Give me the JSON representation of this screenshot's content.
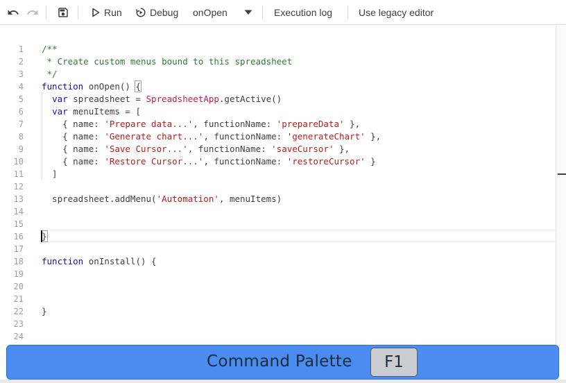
{
  "toolbar": {
    "undo_icon": "undo-icon",
    "redo_icon": "redo-icon",
    "save_icon": "save-icon",
    "run_label": "Run",
    "debug_label": "Debug",
    "function_select": "onOpen",
    "execution_log_label": "Execution log",
    "legacy_editor_label": "Use legacy editor"
  },
  "editor": {
    "line_numbers": [
      "1",
      "2",
      "3",
      "4",
      "5",
      "6",
      "7",
      "8",
      "9",
      "10",
      "11",
      "12",
      "13",
      "14",
      "15",
      "16",
      "17",
      "18",
      "19",
      "20",
      "21",
      "22",
      "23",
      "24"
    ],
    "cursor_line": "14",
    "code": [
      [
        {
          "t": "c",
          "s": "/**"
        }
      ],
      [
        {
          "t": "c",
          "s": " * Create custom menus bound to this spreadsheet"
        }
      ],
      [
        {
          "t": "c",
          "s": " */"
        }
      ],
      [
        {
          "t": "k",
          "s": "function"
        },
        {
          "t": "p",
          "s": " onOpen() "
        },
        {
          "t": "b",
          "s": "{"
        }
      ],
      [
        {
          "t": "p",
          "s": "  "
        },
        {
          "t": "k",
          "s": "var"
        },
        {
          "t": "p",
          "s": " spreadsheet = "
        },
        {
          "t": "x",
          "s": "SpreadsheetApp"
        },
        {
          "t": "p",
          "s": ".getActive()"
        }
      ],
      [
        {
          "t": "p",
          "s": "  "
        },
        {
          "t": "k",
          "s": "var"
        },
        {
          "t": "p",
          "s": " menuItems = ["
        }
      ],
      [
        {
          "t": "p",
          "s": "    { name: "
        },
        {
          "t": "s",
          "s": "'Prepare data...'"
        },
        {
          "t": "p",
          "s": ", functionName: "
        },
        {
          "t": "s",
          "s": "'prepareData'"
        },
        {
          "t": "p",
          "s": " },"
        }
      ],
      [
        {
          "t": "p",
          "s": "    { name: "
        },
        {
          "t": "s",
          "s": "'Generate chart...'"
        },
        {
          "t": "p",
          "s": ", functionName: "
        },
        {
          "t": "s",
          "s": "'generateChart'"
        },
        {
          "t": "p",
          "s": " },"
        }
      ],
      [
        {
          "t": "p",
          "s": "    { name: "
        },
        {
          "t": "s",
          "s": "'Save Cursor...'"
        },
        {
          "t": "p",
          "s": ", functionName: "
        },
        {
          "t": "s",
          "s": "'saveCursor'"
        },
        {
          "t": "p",
          "s": " },"
        }
      ],
      [
        {
          "t": "p",
          "s": "    { name: "
        },
        {
          "t": "s",
          "s": "'Restore Cursor...'"
        },
        {
          "t": "p",
          "s": ", functionName: "
        },
        {
          "t": "s",
          "s": "'restoreCursor'"
        },
        {
          "t": "p",
          "s": " }"
        }
      ],
      [
        {
          "t": "p",
          "s": "  ]"
        }
      ],
      [],
      [
        {
          "t": "p",
          "s": "  spreadsheet.addMenu("
        },
        {
          "t": "s",
          "s": "'Automation'"
        },
        {
          "t": "p",
          "s": ", menuItems)"
        }
      ],
      [],
      [],
      [
        {
          "t": "b",
          "s": "}"
        }
      ],
      [],
      [
        {
          "t": "k",
          "s": "function"
        },
        {
          "t": "p",
          "s": " onInstall() {"
        }
      ],
      [],
      [],
      [],
      [
        {
          "t": "p",
          "s": "}"
        }
      ],
      [],
      []
    ]
  },
  "palette": {
    "label": "Command Palette",
    "key": "F1"
  },
  "colors": {
    "keyword": "#1a0dab",
    "comment": "#2e7d32",
    "string": "#b71c1c",
    "class": "#c2185b",
    "palette_bg": "#4a8cf0"
  }
}
